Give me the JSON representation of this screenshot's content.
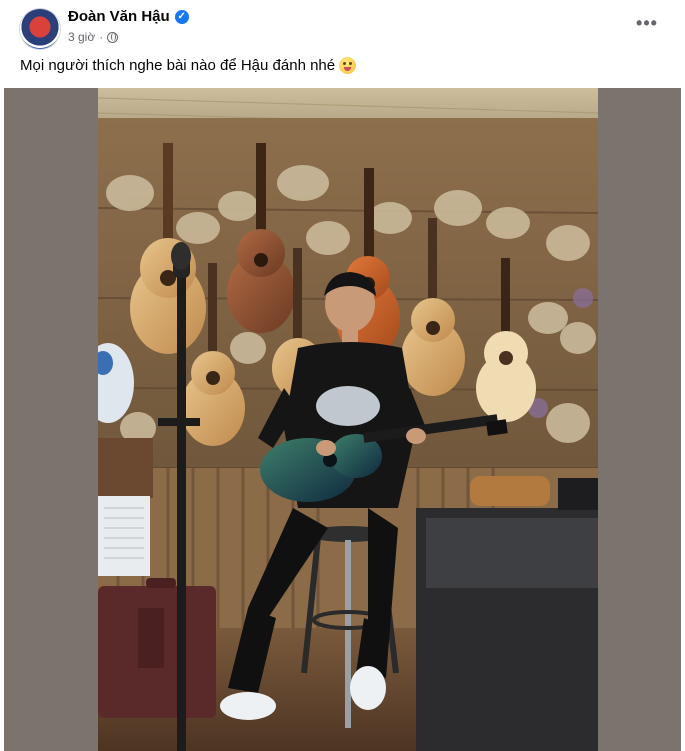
{
  "post": {
    "author_name": "Đoàn Văn Hậu",
    "verified_mark": "✓",
    "time": "3 giờ",
    "separator": "·",
    "more_label": "•••",
    "caption": "Mọi người thích nghe bài nào để Hậu đánh nhé"
  },
  "icons": {
    "verified": "verified-badge-icon",
    "audience": "globe-icon",
    "more": "more-options-icon",
    "emoji": "winking-tongue-emoji-icon"
  },
  "colors": {
    "author_text": "#050505",
    "meta_text": "#65676b",
    "verified_blue": "#1877f2",
    "photo_side_bg": "#7b746e"
  },
  "photo": {
    "alt": "Người đàn ông ngồi trên ghế cao ôm đàn guitar xanh trước bức tường treo nhiều đàn guitar và hoa khô"
  }
}
